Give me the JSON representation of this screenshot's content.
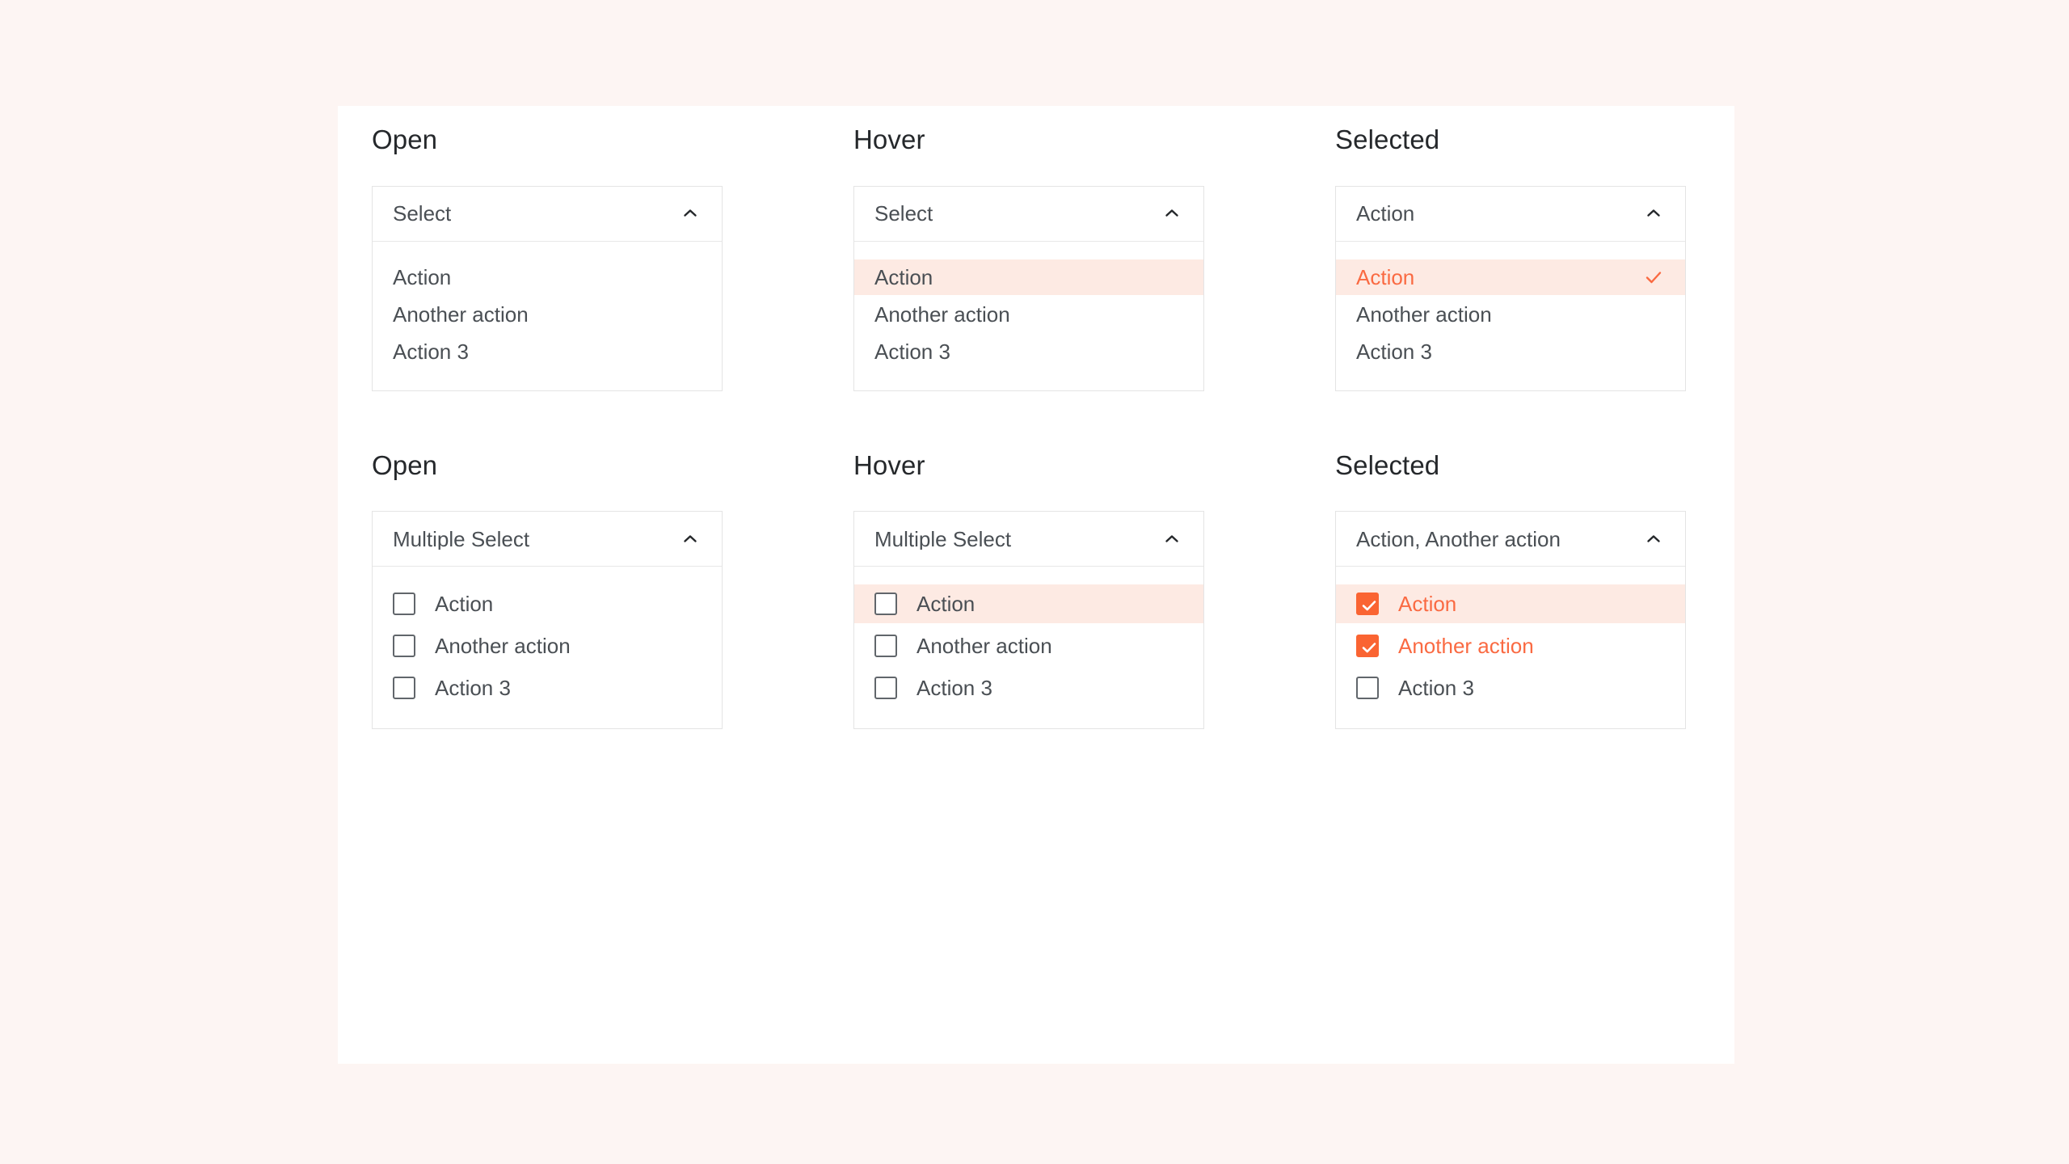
{
  "theme": {
    "page_background": "#fdf5f3",
    "card_background": "#ffffff",
    "accent": "#fa6432",
    "accent_text": "#fa6a42",
    "hover_background": "#fdeae3",
    "border": "#e4e4e4",
    "text": "#4a4f54",
    "heading_text": "#25282b"
  },
  "sections": [
    {
      "id": "single-select",
      "columns": [
        {
          "id": "single-open",
          "heading": "Open",
          "trigger": {
            "label": "Select",
            "icon": "chevron-up-icon"
          },
          "options": [
            {
              "label": "Action",
              "hovered": false,
              "selected": false
            },
            {
              "label": "Another action",
              "hovered": false,
              "selected": false
            },
            {
              "label": "Action 3",
              "hovered": false,
              "selected": false
            }
          ]
        },
        {
          "id": "single-hover",
          "heading": "Hover",
          "trigger": {
            "label": "Select",
            "icon": "chevron-up-icon"
          },
          "options": [
            {
              "label": "Action",
              "hovered": true,
              "selected": false
            },
            {
              "label": "Another action",
              "hovered": false,
              "selected": false
            },
            {
              "label": "Action 3",
              "hovered": false,
              "selected": false
            }
          ]
        },
        {
          "id": "single-selected",
          "heading": "Selected",
          "trigger": {
            "label": "Action",
            "icon": "chevron-up-icon"
          },
          "options": [
            {
              "label": "Action",
              "hovered": true,
              "selected": true
            },
            {
              "label": "Another action",
              "hovered": false,
              "selected": false
            },
            {
              "label": "Action 3",
              "hovered": false,
              "selected": false
            }
          ]
        }
      ]
    },
    {
      "id": "multi-select",
      "columns": [
        {
          "id": "multi-open",
          "heading": "Open",
          "trigger": {
            "label": "Multiple Select",
            "icon": "chevron-up-icon"
          },
          "options": [
            {
              "label": "Action",
              "hovered": false,
              "checked": false
            },
            {
              "label": "Another action",
              "hovered": false,
              "checked": false
            },
            {
              "label": "Action 3",
              "hovered": false,
              "checked": false
            }
          ]
        },
        {
          "id": "multi-hover",
          "heading": "Hover",
          "trigger": {
            "label": "Multiple Select",
            "icon": "chevron-up-icon"
          },
          "options": [
            {
              "label": "Action",
              "hovered": true,
              "checked": false
            },
            {
              "label": "Another action",
              "hovered": false,
              "checked": false
            },
            {
              "label": "Action 3",
              "hovered": false,
              "checked": false
            }
          ]
        },
        {
          "id": "multi-selected",
          "heading": "Selected",
          "trigger": {
            "label": "Action, Another action",
            "icon": "chevron-up-icon"
          },
          "options": [
            {
              "label": "Action",
              "hovered": true,
              "checked": true
            },
            {
              "label": "Another action",
              "hovered": false,
              "checked": true
            },
            {
              "label": "Action 3",
              "hovered": false,
              "checked": false
            }
          ]
        }
      ]
    }
  ]
}
